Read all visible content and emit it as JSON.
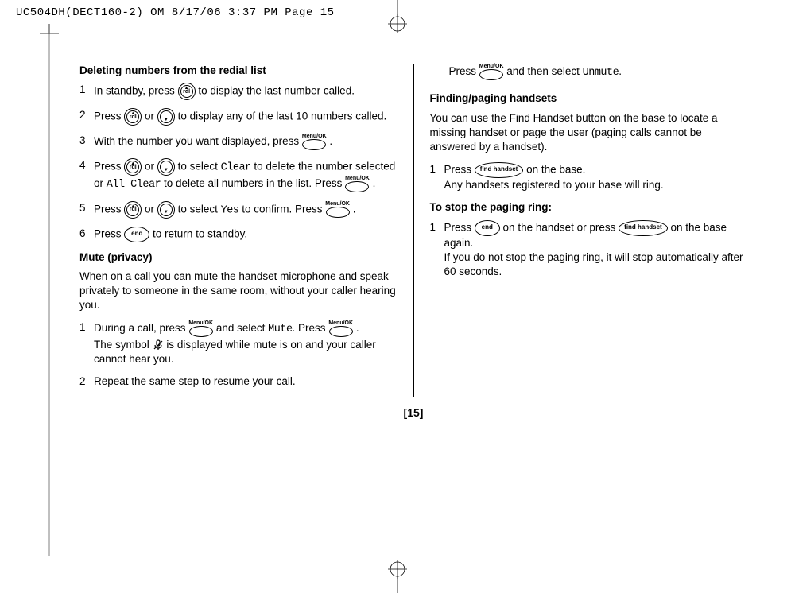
{
  "slug": "UC504DH(DECT160-2) OM  8/17/06  3:37 PM  Page 15",
  "left": {
    "h1": "Deleting numbers from the redial list",
    "s1": "In standby, press",
    "s1b": "to display the last number called.",
    "s2": "Press",
    "s2mid": "or",
    "s2b": "to display any of the last 10 numbers called.",
    "s3": "With the number you want displayed, press",
    "s3dot": ".",
    "s4": "Press",
    "s4mid": "or",
    "s4c": "to select",
    "s4clear": "Clear",
    "s4d": "to delete the number selected or",
    "s4all": "All Clear",
    "s4e": "to delete all numbers in the list. Press",
    "s4dot": ".",
    "s5": "Press",
    "s5mid": "or",
    "s5c": "to select",
    "s5yes": "Yes",
    "s5d": "to confirm. Press",
    "s5dot": ".",
    "s6": "Press",
    "s6b": "to return to standby.",
    "h2": "Mute (privacy)",
    "p2": "When on a call you can mute the handset microphone and speak privately to someone in the same room, without your caller hearing you.",
    "m1": "During a call, press",
    "m1b": "and select",
    "m1mute": "Mute",
    "m1c": ". Press",
    "m1dot": ".",
    "m1d": "The symbol",
    "m1e": "is displayed while mute is on and your caller cannot hear you.",
    "m2": "Repeat the same step to resume your call."
  },
  "right": {
    "r1": "Press",
    "r1b": "and then select",
    "r1un": "Unmute",
    "r1dot": ".",
    "h3": "Finding/paging handsets",
    "p3": "You can use the Find Handset button on the base to locate a missing handset or page the user (paging calls cannot be answered by a handset).",
    "f1": "Press",
    "f1b": "on the base.",
    "f1c": "Any handsets registered to your base will ring.",
    "h4": "To stop the paging ring:",
    "t1": "Press",
    "t1b": "on the handset or press",
    "t1c": "on the base again.",
    "t1d": "If you do not stop the paging ring, it will stop automatically after 60 seconds."
  },
  "buttons": {
    "menuok": "Menu/OK",
    "end": "end",
    "find": "find handset",
    "rdl": "rdl"
  },
  "pagenum": "[15]"
}
